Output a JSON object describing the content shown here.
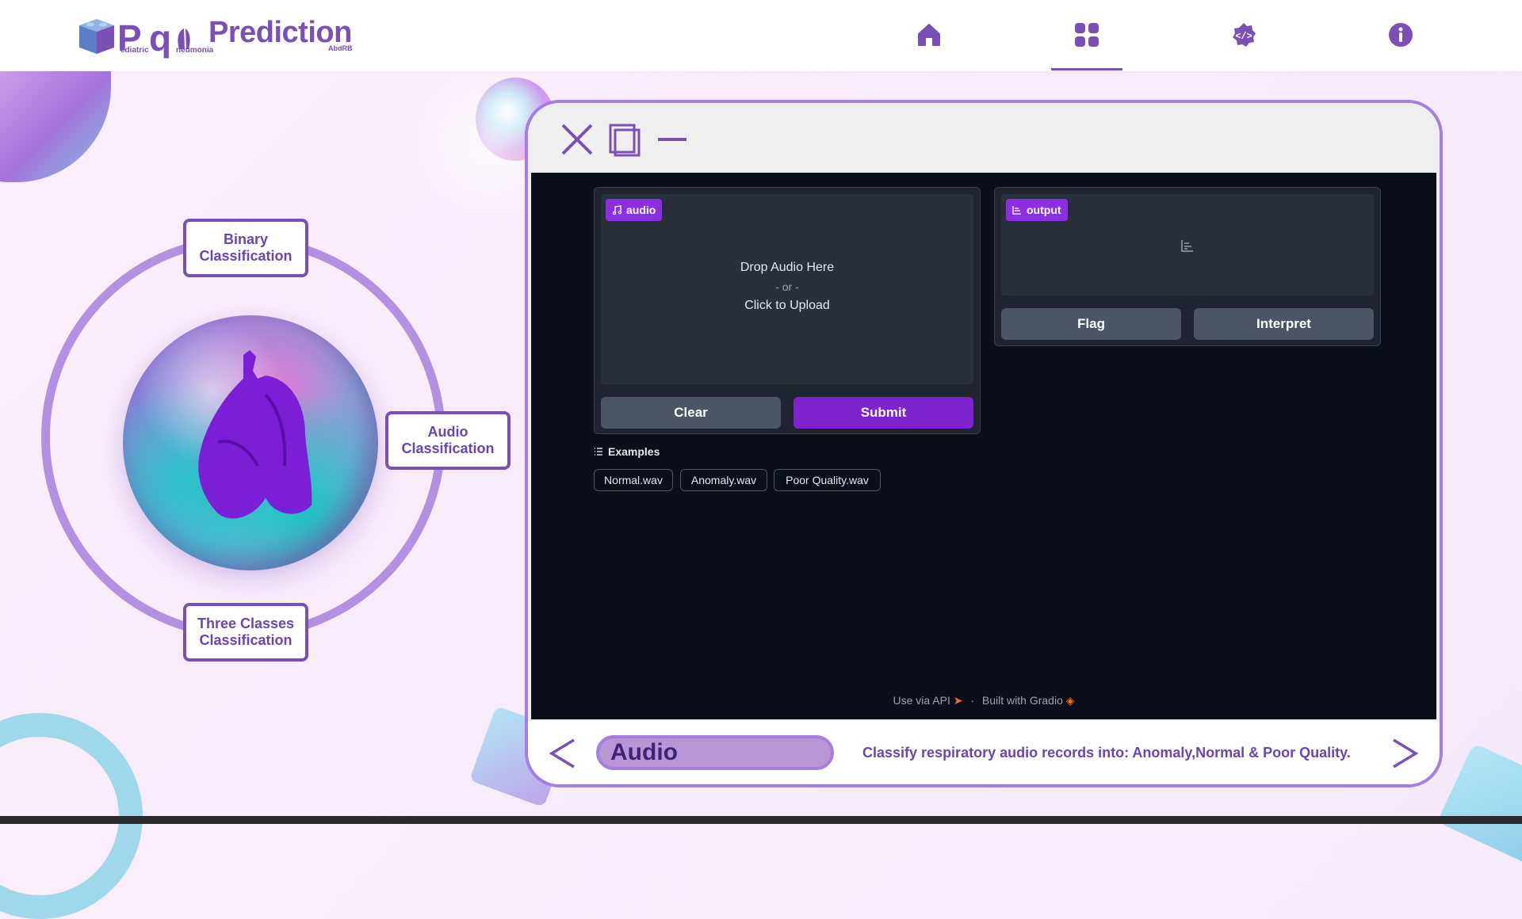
{
  "header": {
    "logo_text": "Prediction",
    "logo_sub1": "ediatric",
    "logo_sub2": "neumonia",
    "logo_sub3": "AbdRB",
    "nav": [
      {
        "icon": "home-icon"
      },
      {
        "icon": "apps-grid-icon"
      },
      {
        "icon": "code-gear-icon"
      },
      {
        "icon": "info-icon"
      }
    ]
  },
  "classes": {
    "binary": "Binary Classification",
    "audio": "Audio Classification",
    "three": "Three Classes Classification"
  },
  "app": {
    "audio_badge": "audio",
    "drop_line1": "Drop Audio Here",
    "drop_line2": "- or -",
    "drop_line3": "Click to Upload",
    "clear_label": "Clear",
    "submit_label": "Submit",
    "output_badge": "output",
    "flag_label": "Flag",
    "interpret_label": "Interpret",
    "examples_label": "Examples",
    "examples": [
      "Normal.wav",
      "Anomaly.wav",
      "Poor Quality.wav"
    ],
    "footer_api": "Use via API",
    "footer_sep": "·",
    "footer_built": "Built with Gradio"
  },
  "bottom": {
    "mode": "Audio",
    "description": "Classify respiratory audio records into: Anomaly,Normal & Poor Quality."
  },
  "colors": {
    "brand": "#7a4fb6",
    "accent_purple": "#7e22ce",
    "app_bg": "#0b0f19"
  }
}
